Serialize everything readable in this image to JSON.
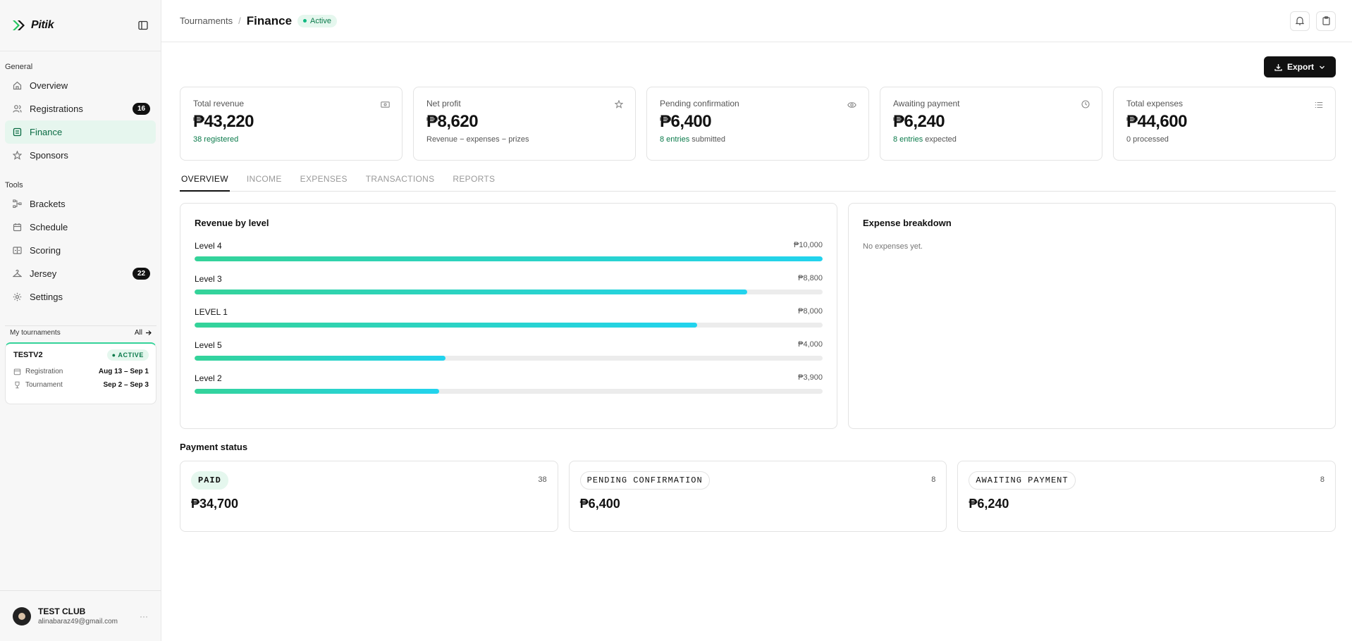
{
  "brand": {
    "name": "Pitik"
  },
  "sidebar": {
    "general_label": "General",
    "tools_label": "Tools",
    "general": [
      {
        "label": "Overview",
        "icon": "home-icon"
      },
      {
        "label": "Registrations",
        "icon": "users-icon",
        "badge": "16"
      },
      {
        "label": "Finance",
        "icon": "finance-icon",
        "active": true
      },
      {
        "label": "Sponsors",
        "icon": "star-icon"
      }
    ],
    "tools": [
      {
        "label": "Brackets",
        "icon": "bracket-icon"
      },
      {
        "label": "Schedule",
        "icon": "calendar-icon"
      },
      {
        "label": "Scoring",
        "icon": "scoreboard-icon"
      },
      {
        "label": "Jersey",
        "icon": "hanger-icon",
        "badge": "22"
      },
      {
        "label": "Settings",
        "icon": "gear-icon"
      }
    ],
    "my_tournaments": {
      "label": "My tournaments",
      "all_label": "All",
      "card": {
        "name": "TESTV2",
        "status": "● ACTIVE",
        "registration_label": "Registration",
        "registration_dates": "Aug 13 – Sep 1",
        "tournament_label": "Tournament",
        "tournament_dates": "Sep 2 – Sep 3"
      }
    },
    "user": {
      "name": "TEST CLUB",
      "email": "alinabaraz49@gmail.com",
      "more": "···"
    }
  },
  "header": {
    "breadcrumb_root": "Tournaments",
    "breadcrumb_sep": "/",
    "title": "Finance",
    "status": "Active"
  },
  "actions": {
    "export_label": "Export"
  },
  "stats": {
    "revenue": {
      "label": "Total revenue",
      "value": "₱43,220",
      "sub_highlight": "38 registered",
      "sub_rest": ""
    },
    "profit": {
      "label": "Net profit",
      "value": "₱8,620",
      "sub_highlight": "",
      "sub_rest": "Revenue − expenses − prizes"
    },
    "pending": {
      "label": "Pending confirmation",
      "value": "₱6,400",
      "sub_highlight": "8 entries",
      "sub_rest": " submitted"
    },
    "awaiting": {
      "label": "Awaiting payment",
      "value": "₱6,240",
      "sub_highlight": "8 entries",
      "sub_rest": " expected"
    },
    "expenses": {
      "label": "Total expenses",
      "value": "₱44,600",
      "sub_highlight": "",
      "sub_rest": "0 processed"
    }
  },
  "tabs": [
    "OVERVIEW",
    "INCOME",
    "EXPENSES",
    "TRANSACTIONS",
    "REPORTS"
  ],
  "revenue_by_level": {
    "title": "Revenue by level",
    "items": [
      {
        "label": "Level 4",
        "value": "₱10,000",
        "pct": 100
      },
      {
        "label": "Level 3",
        "value": "₱8,800",
        "pct": 88
      },
      {
        "label": "LEVEL 1",
        "value": "₱8,000",
        "pct": 80
      },
      {
        "label": "Level 5",
        "value": "₱4,000",
        "pct": 40
      },
      {
        "label": "Level 2",
        "value": "₱3,900",
        "pct": 39
      }
    ]
  },
  "expense_breakdown": {
    "title": "Expense breakdown",
    "empty": "No expenses yet."
  },
  "payment_status": {
    "title": "Payment status",
    "paid": {
      "tag": "PAID",
      "count": "38",
      "amount": "₱34,700"
    },
    "pending": {
      "tag": "PENDING CONFIRMATION",
      "count": "8",
      "amount": "₱6,400"
    },
    "awaiting": {
      "tag": "AWAITING PAYMENT",
      "count": "8",
      "amount": "₱6,240"
    }
  },
  "colors": {
    "accent": "#10b981",
    "bar_start": "#34d399",
    "bar_end": "#22d3ee",
    "active_bg": "#e6f6ee"
  }
}
